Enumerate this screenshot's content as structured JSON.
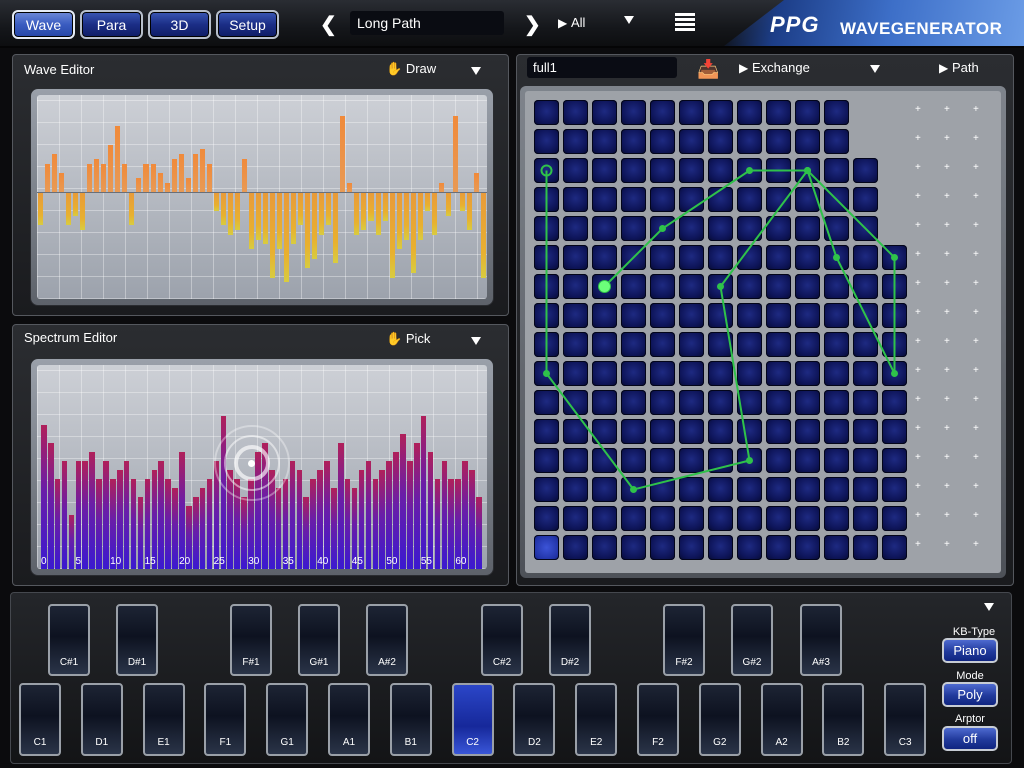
{
  "topbar": {
    "tabs": [
      "Wave",
      "Para",
      "3D",
      "Setup"
    ],
    "active_tab": "Wave",
    "preset_name": "Long Path",
    "filter_label": "All",
    "brand_logo": "PPG",
    "brand_name": "WAVEGENERATOR"
  },
  "wave_editor": {
    "title": "Wave Editor",
    "mode": "Draw",
    "bar_values": [
      -0.35,
      0.3,
      0.4,
      0.2,
      -0.35,
      -0.25,
      -0.4,
      0.3,
      0.35,
      0.3,
      0.5,
      0.7,
      0.3,
      -0.35,
      0.15,
      0.3,
      0.3,
      0.2,
      0.1,
      0.35,
      0.4,
      0.15,
      0.4,
      0.45,
      0.3,
      -0.2,
      -0.35,
      -0.45,
      -0.4,
      0.35,
      -0.6,
      -0.5,
      -0.55,
      -0.9,
      -0.6,
      -0.95,
      -0.55,
      -0.35,
      -0.8,
      -0.7,
      -0.45,
      -0.35,
      -0.75,
      0.8,
      0.1,
      -0.45,
      -0.4,
      -0.3,
      -0.45,
      -0.3,
      -0.9,
      -0.6,
      -0.5,
      -0.85,
      -0.5,
      -0.2,
      -0.45,
      0.1,
      -0.25,
      0.8,
      -0.2,
      -0.4,
      0.2,
      -0.9
    ],
    "colors": {
      "pos": "#f08a3a",
      "neg": "#e8b030"
    }
  },
  "spectrum_editor": {
    "title": "Spectrum Editor",
    "mode": "Pick",
    "bar_values": [
      0.8,
      0.7,
      0.5,
      0.6,
      0.3,
      0.6,
      0.6,
      0.65,
      0.5,
      0.6,
      0.5,
      0.55,
      0.6,
      0.5,
      0.4,
      0.5,
      0.55,
      0.6,
      0.5,
      0.45,
      0.65,
      0.35,
      0.4,
      0.45,
      0.5,
      0.6,
      0.85,
      0.55,
      0.5,
      0.4,
      0.5,
      0.65,
      0.7,
      0.55,
      0.45,
      0.5,
      0.6,
      0.55,
      0.4,
      0.5,
      0.55,
      0.6,
      0.45,
      0.7,
      0.5,
      0.45,
      0.55,
      0.6,
      0.5,
      0.55,
      0.6,
      0.65,
      0.75,
      0.6,
      0.7,
      0.85,
      0.65,
      0.5,
      0.6,
      0.5,
      0.5,
      0.6,
      0.55,
      0.4
    ],
    "tick_labels": [
      "0",
      "5",
      "10",
      "15",
      "20",
      "25",
      "30",
      "35",
      "40",
      "45",
      "50",
      "55",
      "60"
    ],
    "pick_index": 30
  },
  "path_panel": {
    "wave_name": "full1",
    "exchange_label": "Exchange",
    "path_label": "Path",
    "path_points": [
      [
        0,
        2
      ],
      [
        0,
        9
      ],
      [
        3,
        13
      ],
      [
        7,
        12
      ],
      [
        6,
        6
      ],
      [
        9,
        2
      ],
      [
        10,
        5
      ],
      [
        12,
        9
      ],
      [
        12,
        5
      ],
      [
        9,
        2
      ],
      [
        7,
        2
      ],
      [
        4,
        4
      ],
      [
        2,
        6
      ]
    ],
    "selected_cell": [
      0,
      15
    ]
  },
  "keyboard": {
    "black_keys": [
      "C#1",
      "D#1",
      "F#1",
      "G#1",
      "A#2",
      "C#2",
      "D#2",
      "F#2",
      "G#2",
      "A#3"
    ],
    "white_keys": [
      "C1",
      "D1",
      "E1",
      "F1",
      "G1",
      "A1",
      "B1",
      "C2",
      "D2",
      "E2",
      "F2",
      "G2",
      "A2",
      "B2",
      "C3"
    ],
    "active_key": "C2",
    "kb_type_label": "KB-Type",
    "kb_type_value": "Piano",
    "mode_label": "Mode",
    "mode_value": "Poly",
    "arptor_label": "Arptor",
    "arptor_value": "off"
  }
}
